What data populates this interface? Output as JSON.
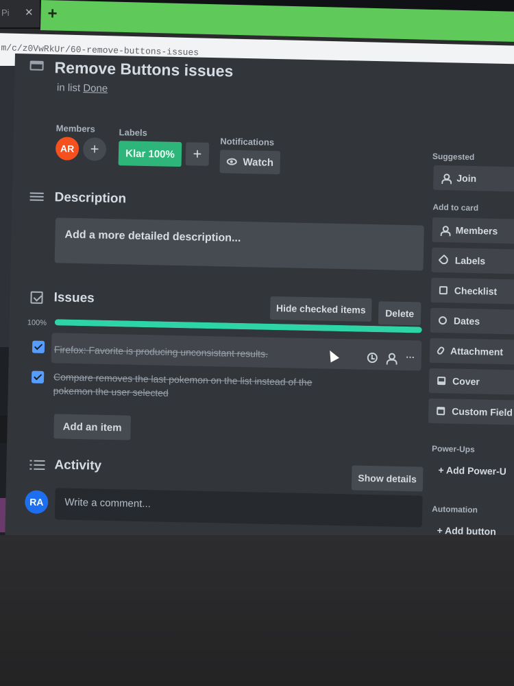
{
  "browser": {
    "tab_stub_text": "Pi",
    "tab_close": "✕",
    "new_tab_symbol": "+",
    "url": "m/c/z0VwRkUr/60-remove-buttons-issues"
  },
  "card": {
    "title": "Remove Buttons issues",
    "in_list_prefix": "in list",
    "list_name": "Done"
  },
  "meta": {
    "members_label": "Members",
    "member_initials": "AR",
    "member_color": "#f4511e",
    "labels_label": "Labels",
    "label_text": "Klar 100%",
    "label_color": "#2eb57a",
    "notifications_label": "Notifications",
    "watch_label": "Watch",
    "add_symbol": "+"
  },
  "description": {
    "title": "Description",
    "placeholder": "Add a more detailed description..."
  },
  "checklist": {
    "title": "Issues",
    "hide_checked_label": "Hide checked items",
    "delete_label": "Delete",
    "percent_text": "100%",
    "progress": 1.0,
    "progress_color": "#2dd4a6",
    "items": [
      {
        "text": "Firefox: Favorite is producing unconsistant results.",
        "checked": true
      },
      {
        "text": "Compare removes the last pokemon on the list instead of the pokemon the user selected",
        "checked": true
      }
    ],
    "more_icon": "···",
    "add_item_label": "Add an item"
  },
  "activity": {
    "title": "Activity",
    "show_details_label": "Show details",
    "user_initials": "RA",
    "user_color": "#1e6ff0",
    "comment_placeholder": "Write a comment..."
  },
  "sidebar": {
    "suggested_label": "Suggested",
    "join_label": "Join",
    "add_to_card_label": "Add to card",
    "buttons": [
      {
        "label": "Members",
        "icon": "user-icon"
      },
      {
        "label": "Labels",
        "icon": "tag-icon"
      },
      {
        "label": "Checklist",
        "icon": "checklist-icon"
      },
      {
        "label": "Dates",
        "icon": "clock-icon"
      },
      {
        "label": "Attachment",
        "icon": "paperclip-icon"
      },
      {
        "label": "Cover",
        "icon": "cover-icon"
      },
      {
        "label": "Custom Field",
        "icon": "custom-field-icon"
      }
    ],
    "powerups_label": "Power-Ups",
    "add_powerups_label": "+ Add Power-U",
    "automation_label": "Automation",
    "add_button_label": "+ Add button"
  }
}
